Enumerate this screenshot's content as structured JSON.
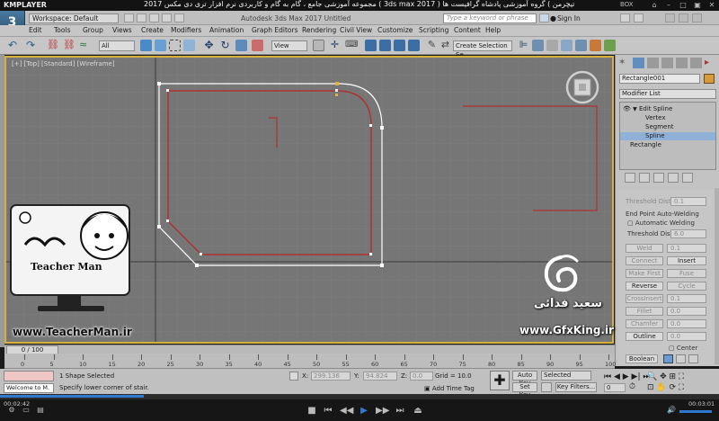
{
  "player": {
    "app_name": "KMPLAYER",
    "course_title": "مجموعه آموزشی جامع ، گام به گام و کاربردی نرم افزار تری دی مکس 2017 ( 3ds max 2017 ) مدرس : سعید فدائی ( تیچرمن ) گروه آموزشی پادشاه گرافیست ها",
    "box_label": "BOX",
    "time_current": "00:02:42",
    "time_total": "00:03:01",
    "progress": 0.2
  },
  "app": {
    "logo": "3",
    "logo_sub": "MAX",
    "workspace": "Workspace: Default",
    "title": "Autodesk 3ds Max 2017    Untitled",
    "search_placeholder": "Type a keyword or phrase",
    "sign_in": "Sign In"
  },
  "menu": [
    "Edit",
    "Tools",
    "Group",
    "Views",
    "Create",
    "Modifiers",
    "Animation",
    "Graph Editors",
    "Rendering",
    "Civil View",
    "Customize",
    "Scripting",
    "Content",
    "Help"
  ],
  "toolbar": {
    "filter": "All",
    "ref_coord": "View",
    "selection_set": "Create Selection Se"
  },
  "viewport": {
    "label": "[+] [Top] [Standard] [Wireframe]",
    "grid_color": "#8a8a8a",
    "spline_color": "#c03030",
    "selection_color": "#ffffff"
  },
  "command_panel": {
    "object_name": "Rectangle001",
    "modifier_list": "Modifier List",
    "stack": [
      "Edit Spline",
      "Vertex",
      "Segment",
      "Spline",
      "Rectangle"
    ],
    "stack_selected": "Spline",
    "rollout": {
      "threshold_dist_label": "Threshold Dist",
      "threshold_dist_val": "0.1",
      "end_point_auto_welding": "End Point Auto-Welding",
      "automatic_welding": "Automatic Welding",
      "threshold_dist2_label": "Threshold Dist",
      "threshold_dist2_val": "6.0",
      "weld_label": "Weld",
      "weld_val": "0.1",
      "connect": "Connect",
      "insert": "Insert",
      "make_first": "Make First",
      "fuse": "Fuse",
      "reverse": "Reverse",
      "cycle": "Cycle",
      "crossinsert_label": "CrossInsert",
      "crossinsert_val": "0.1",
      "fillet_label": "Fillet",
      "fillet_val": "0.0",
      "chamfer_label": "Chamfer",
      "chamfer_val": "0.0",
      "outline": "Outline",
      "outline_val": "0.0",
      "center": "Center",
      "boolean": "Boolean"
    }
  },
  "timeline": {
    "slider": "0 / 100",
    "ticks": [
      "0",
      "5",
      "10",
      "15",
      "20",
      "25",
      "30",
      "35",
      "40",
      "45",
      "50",
      "55",
      "60",
      "65",
      "70",
      "75",
      "80",
      "85",
      "90",
      "95",
      "100"
    ]
  },
  "status": {
    "welcome": "Welcome to M.",
    "selected": "1 Shape Selected",
    "prompt": "Specify lower corner of stair.",
    "x_label": "X:",
    "x_val": "299.136",
    "y_label": "Y:",
    "y_val": "94.824",
    "z_label": "Z:",
    "z_val": "0.0",
    "grid": "Grid = 10.0",
    "add_time_tag": "Add Time Tag",
    "auto_key": "Auto Key",
    "set_key": "Set Key",
    "selected_drop": "Selected",
    "key_filters": "Key Filters..."
  },
  "overlays": {
    "teacherman_site": "www.TeacherMan.ir",
    "teacherman_name": "Teacher Man",
    "gfxking_name": "سعید فدائی",
    "gfxking_site": "www.GfxKing.ir"
  }
}
